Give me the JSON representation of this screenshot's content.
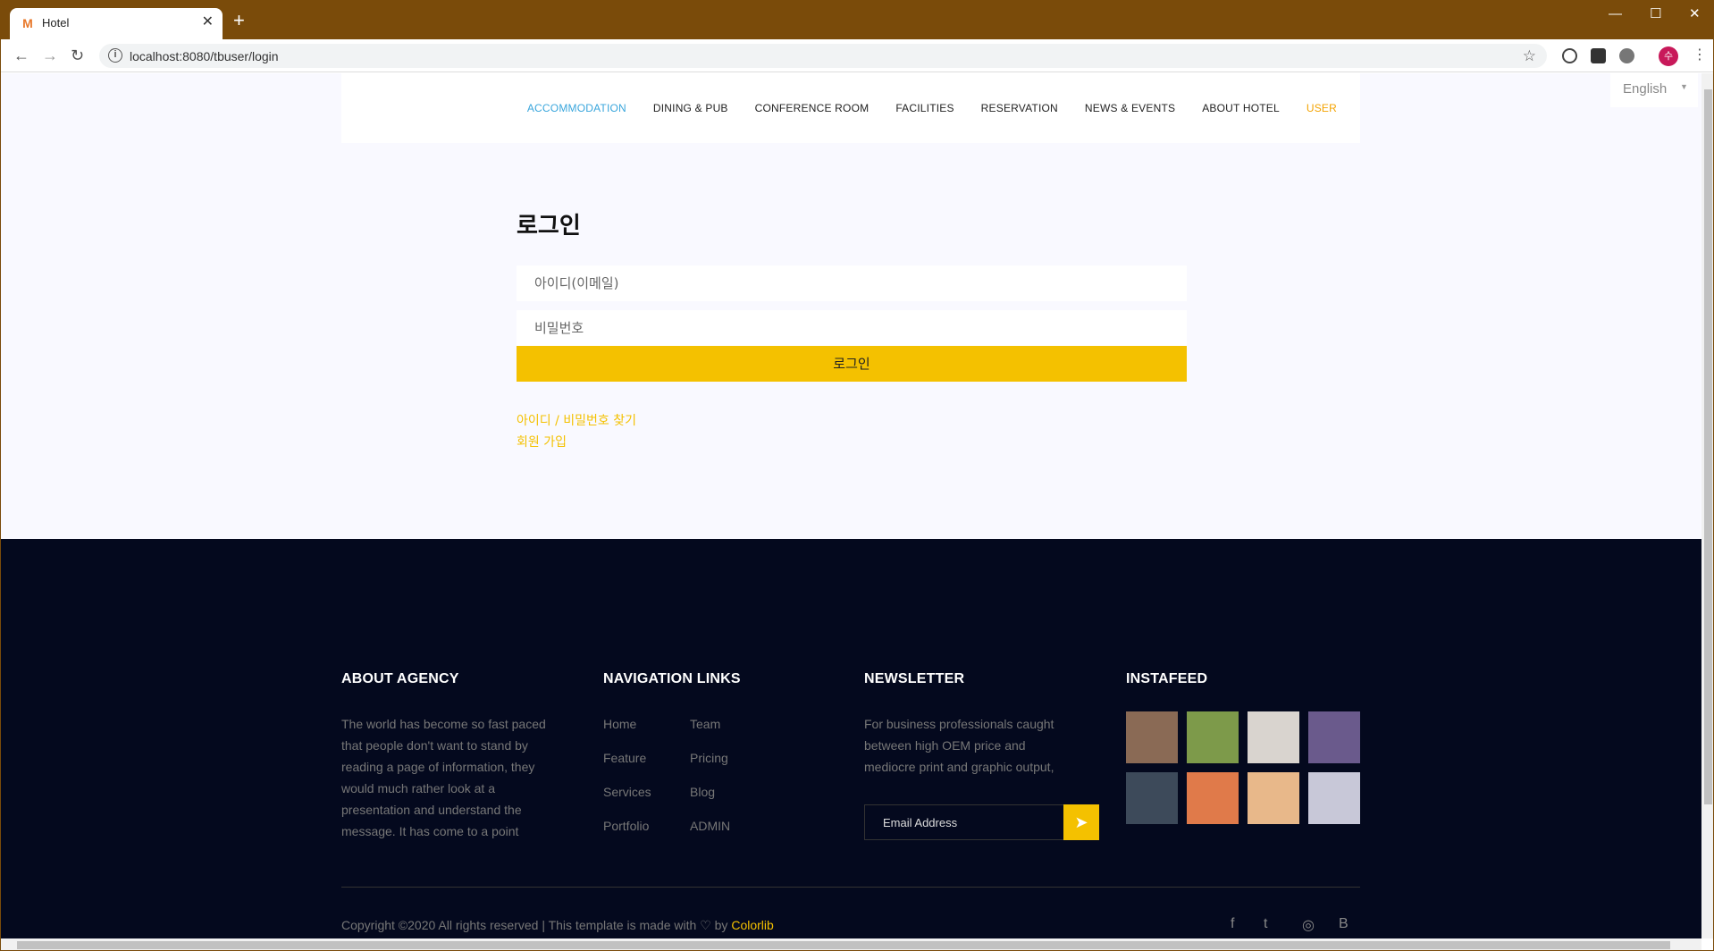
{
  "browser": {
    "tab_title": "Hotel",
    "tab_favicon": "M",
    "tab_close": "✕",
    "new_tab": "+",
    "url": "localhost:8080/tbuser/login",
    "win_minimize": "—",
    "win_maximize": "☐",
    "win_close": "✕",
    "avatar_letter": "수"
  },
  "header": {
    "nav": [
      {
        "label": "ACCOMMODATION",
        "color": "#3aa6dc"
      },
      {
        "label": "DINING & PUB",
        "color": "#222222"
      },
      {
        "label": "CONFERENCE ROOM",
        "color": "#222222"
      },
      {
        "label": "FACILITIES",
        "color": "#222222"
      },
      {
        "label": "RESERVATION",
        "color": "#222222"
      },
      {
        "label": "NEWS & EVENTS",
        "color": "#222222"
      },
      {
        "label": "ABOUT HOTEL",
        "color": "#222222"
      },
      {
        "label": "USER",
        "color": "#f4a300"
      }
    ],
    "language": "English"
  },
  "login": {
    "title": "로그인",
    "id_placeholder": "아이디(이메일)",
    "pw_placeholder": "비밀번호",
    "button": "로그인",
    "find_link": "아이디 / 비밀번호 찾기",
    "signup_link": "회원 가입"
  },
  "footer": {
    "about": {
      "heading": "ABOUT AGENCY",
      "lines": [
        "The world has become so fast paced",
        "that people don't want to stand by",
        "reading a page of information, they",
        "would much rather look at a",
        "presentation and understand the",
        "message. It has come to a point"
      ]
    },
    "nav": {
      "heading": "NAVIGATION LINKS",
      "col1": [
        "Home",
        "Feature",
        "Services",
        "Portfolio"
      ],
      "col2": [
        "Team",
        "Pricing",
        "Blog",
        "ADMIN"
      ]
    },
    "newsletter": {
      "heading": "NEWSLETTER",
      "lines": [
        "For business professionals caught",
        "between high OEM price and",
        "mediocre print and graphic output,"
      ],
      "email_placeholder": "Email Address",
      "send_icon": "➤"
    },
    "instafeed": {
      "heading": "INSTAFEED",
      "colors": [
        "#8a6a55",
        "#7d9a4a",
        "#d9d4cf",
        "#6a5a8c",
        "#3d4a5a",
        "#e07a4a",
        "#e8b88a",
        "#c8c8d8"
      ]
    },
    "copyright_prefix": "Copyright ©2020 All rights reserved | This template is made with ♡ by ",
    "copyright_brand": "Colorlib",
    "social": [
      "f",
      "t",
      "◎",
      "B"
    ]
  }
}
